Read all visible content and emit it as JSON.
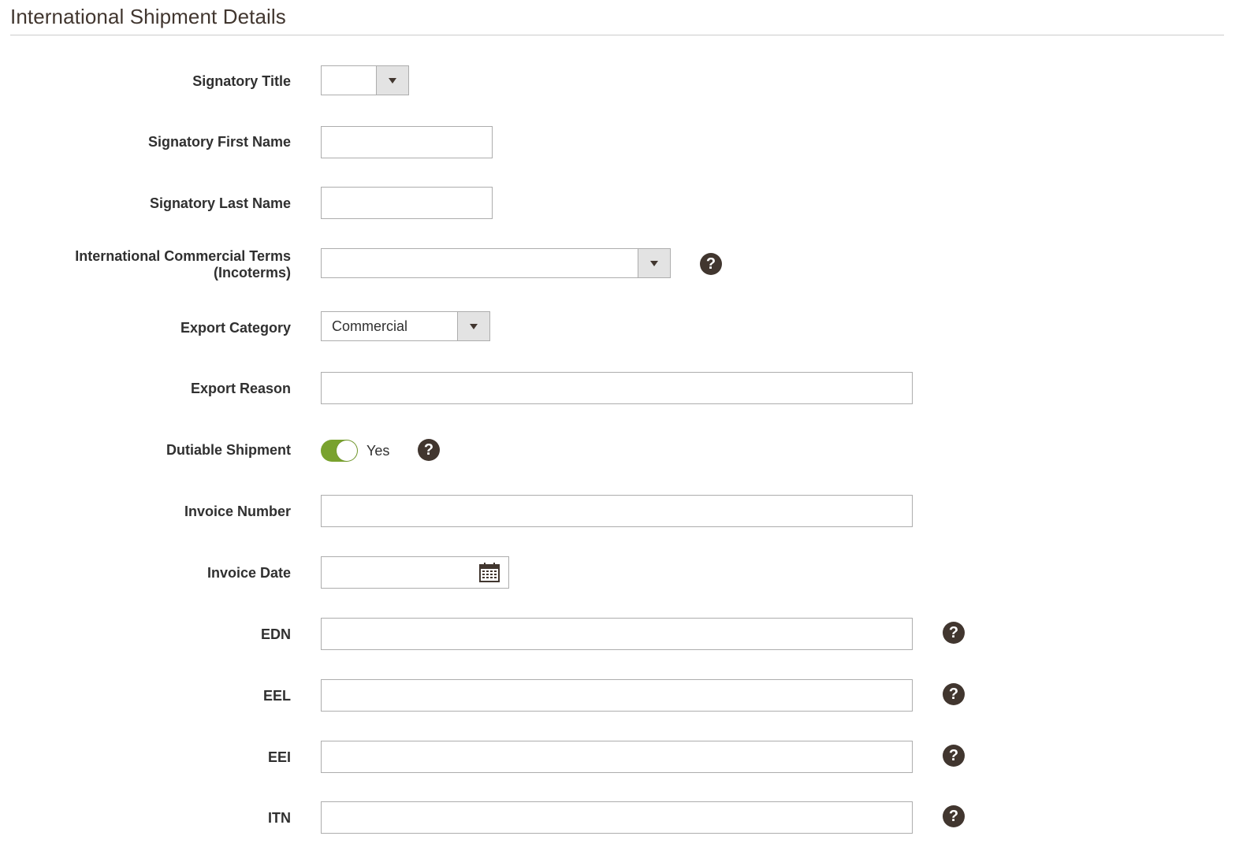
{
  "section": {
    "title": "International Shipment Details"
  },
  "fields": {
    "signatory_title": {
      "label": "Signatory Title",
      "value": ""
    },
    "signatory_first_name": {
      "label": "Signatory First Name",
      "value": ""
    },
    "signatory_last_name": {
      "label": "Signatory Last Name",
      "value": ""
    },
    "incoterms": {
      "label_line1": "International Commercial Terms",
      "label_line2": "(Incoterms)",
      "value": ""
    },
    "export_category": {
      "label": "Export Category",
      "value": "Commercial"
    },
    "export_reason": {
      "label": "Export Reason",
      "value": ""
    },
    "dutiable_shipment": {
      "label": "Dutiable Shipment",
      "state_label": "Yes",
      "checked": true
    },
    "invoice_number": {
      "label": "Invoice Number",
      "value": ""
    },
    "invoice_date": {
      "label": "Invoice Date",
      "value": ""
    },
    "edn": {
      "label": "EDN",
      "value": ""
    },
    "eel": {
      "label": "EEL",
      "value": ""
    },
    "eei": {
      "label": "EEI",
      "value": ""
    },
    "itn": {
      "label": "ITN",
      "value": ""
    }
  },
  "help_glyph": "?",
  "icons": {
    "help": "question-circle-icon",
    "calendar": "calendar-icon",
    "dropdown": "chevron-down-icon"
  },
  "colors": {
    "toggle_on": "#79a22e",
    "help_bg": "#41362f",
    "border": "#adadad"
  }
}
